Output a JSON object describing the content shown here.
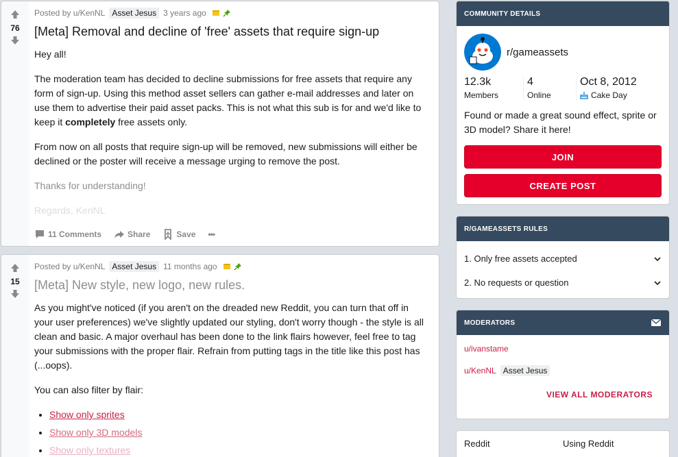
{
  "posts": [
    {
      "score": "76",
      "posted_by": "Posted by u/KenNL",
      "flair": "Asset Jesus",
      "time": "3 years ago",
      "title": "[Meta] Removal and decline of 'free' assets that require sign-up",
      "p1": "Hey all!",
      "p2_a": "The moderation team has decided to decline submissions for free assets that require any form of sign-up. Using this method asset sellers can gather e-mail addresses and later on use them to advertise their paid asset packs. This is not what this sub is for and we'd like to keep it ",
      "p2_bold": "completely",
      "p2_b": " free assets only.",
      "p3": "From now on all posts that require sign-up will be removed, new submissions will either be declined or the poster will receive a message urging to remove the post.",
      "p4": "Thanks for understanding!",
      "p5": "Regards, KenNL",
      "comments": "11 Comments",
      "share": "Share",
      "save": "Save",
      "more": "•••"
    },
    {
      "score": "15",
      "posted_by": "Posted by u/KenNL",
      "flair": "Asset Jesus",
      "time": "11 months ago",
      "title": "[Meta] New style, new logo, new rules.",
      "p1": "As you might've noticed (if you aren't on the dreaded new Reddit, you can turn that off in your user preferences) we've slightly updated our styling, don't worry though - the style is all clean and basic. A major overhaul has been done to the link flairs however, feel free to tag your submissions with the proper flair. Refrain from putting tags in the title like this post has (...oops).",
      "p2": "You can also filter by flair:",
      "links": [
        "Show only sprites",
        "Show only 3D models",
        "Show only textures"
      ]
    }
  ],
  "community": {
    "header": "COMMUNITY DETAILS",
    "name": "r/gameassets",
    "members_num": "12.3k",
    "members_lbl": "Members",
    "online_num": "4",
    "online_lbl": "Online",
    "created_num": "Oct 8, 2012",
    "created_lbl": "Cake Day",
    "description": "Found or made a great sound effect, sprite or 3D model? Share it here!",
    "join": "JOIN",
    "create_post": "CREATE POST"
  },
  "rules": {
    "header": "R/GAMEASSETS RULES",
    "items": [
      "1. Only free assets accepted",
      "2. No requests or question"
    ]
  },
  "moderators": {
    "header": "MODERATORS",
    "mod1": "u/ivanstame",
    "mod2": "u/KenNL",
    "mod2_flair": "Asset Jesus",
    "view_all": "VIEW ALL MODERATORS"
  },
  "footer": {
    "col1": "Reddit",
    "col2": "Using Reddit"
  },
  "colors": {
    "header_bg": "#354a5f",
    "accent_red": "#e4002b",
    "link_red": "#c81f46"
  }
}
